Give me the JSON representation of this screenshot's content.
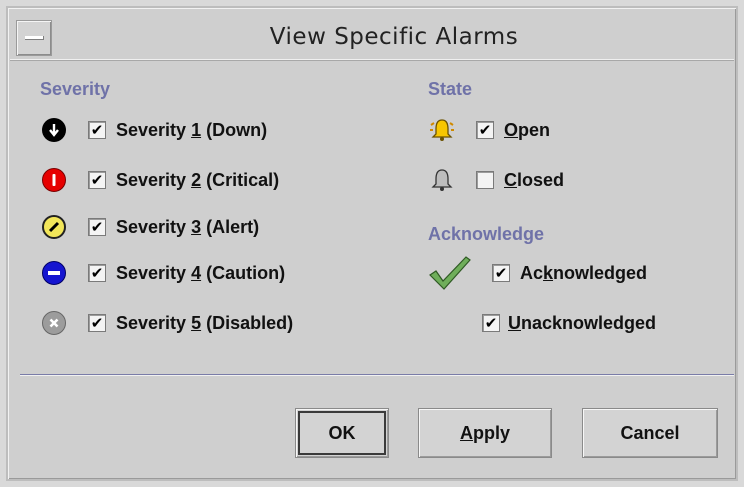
{
  "window": {
    "title": "View Specific Alarms"
  },
  "severity": {
    "heading": "Severity",
    "items": [
      {
        "prefix": "Severity ",
        "num": "1",
        "suffix": " (Down)",
        "checked": "✔",
        "icon": "down-arrow-icon",
        "color": "#000000"
      },
      {
        "prefix": "Severity ",
        "num": "2",
        "suffix": " (Critical)",
        "checked": "✔",
        "icon": "exclamation-icon",
        "color": "#e60000"
      },
      {
        "prefix": "Severity ",
        "num": "3",
        "suffix": " (Alert)",
        "checked": "✔",
        "icon": "alert-slash-icon",
        "color": "#f2e65a"
      },
      {
        "prefix": "Severity ",
        "num": "4",
        "suffix": " (Caution)",
        "checked": "✔",
        "icon": "minus-icon",
        "color": "#1515d0"
      },
      {
        "prefix": "Severity ",
        "num": "5",
        "suffix": " (Disabled)",
        "checked": "✔",
        "icon": "x-icon",
        "color": "#9c9c9c"
      }
    ]
  },
  "state": {
    "heading": "State",
    "open": {
      "first": "O",
      "rest": "pen",
      "checked": "✔",
      "icon": "bell-ringing-icon"
    },
    "closed": {
      "first": "C",
      "rest": "losed",
      "checked": "",
      "icon": "bell-icon"
    }
  },
  "acknowledge": {
    "heading": "Acknowledge",
    "acknowledged": {
      "pre": "Ac",
      "u": "k",
      "post": "nowledged",
      "checked": "✔",
      "icon": "checkmark-icon"
    },
    "unacknowledged": {
      "first": "U",
      "rest": "nacknowledged",
      "checked": "✔"
    }
  },
  "buttons": {
    "ok": "OK",
    "apply_first": "A",
    "apply_rest": "pply",
    "cancel": "Cancel"
  }
}
